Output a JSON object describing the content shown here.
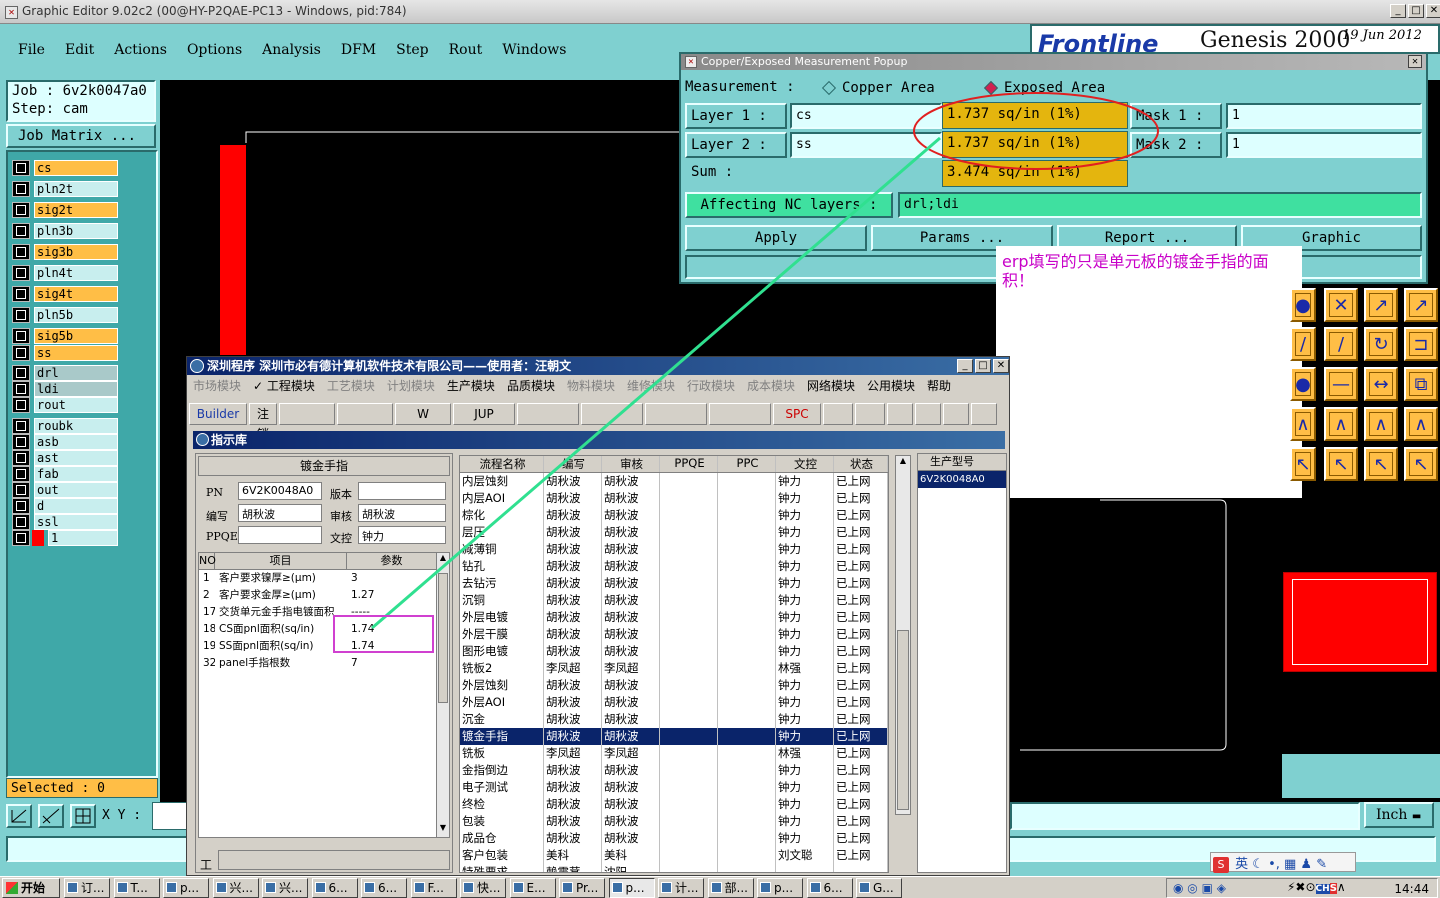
{
  "window": {
    "title": "Graphic Editor 9.02c2 (00@HY-P2QAE-PC13 - Windows, pid:784)"
  },
  "menu": [
    "File",
    "Edit",
    "Actions",
    "Options",
    "Analysis",
    "DFM",
    "Step",
    "Rout",
    "Windows"
  ],
  "banner": {
    "logo": "Frontline",
    "product": "Genesis 2000",
    "date": "19 Jun 2012"
  },
  "job": {
    "job": "Job : 6v2k0047a0",
    "step": "Step: cam",
    "matrix": "Job Matrix ..."
  },
  "layers": [
    {
      "name": "cs",
      "style": "or"
    },
    {
      "name": "pln2t",
      "style": "cy"
    },
    {
      "name": "sig2t",
      "style": "or"
    },
    {
      "name": "pln3b",
      "style": "cy"
    },
    {
      "name": "sig3b",
      "style": "or"
    },
    {
      "name": "pln4t",
      "style": "cy"
    },
    {
      "name": "sig4t",
      "style": "or"
    },
    {
      "name": "pln5b",
      "style": "cy"
    },
    {
      "name": "sig5b",
      "style": "or"
    },
    {
      "name": "ss",
      "style": "or"
    },
    {
      "name": "drl",
      "style": "gr"
    },
    {
      "name": "ldi",
      "style": "gr"
    },
    {
      "name": "rout",
      "style": "cy"
    },
    {
      "name": "roubk",
      "style": "cy"
    },
    {
      "name": "asb",
      "style": "cy"
    },
    {
      "name": "ast",
      "style": "cy"
    },
    {
      "name": "fab",
      "style": "cy"
    },
    {
      "name": "out",
      "style": "cy"
    },
    {
      "name": "d",
      "style": "cy"
    },
    {
      "name": "ssl",
      "style": "cy"
    },
    {
      "name": "1",
      "style": "cy"
    }
  ],
  "selected": "Selected : 0",
  "xy_label": "X Y :",
  "units": "Inch",
  "popup": {
    "title": "Copper/Exposed Measurement Popup",
    "measurement_label": "Measurement :",
    "opt_copper": "Copper Area",
    "opt_exposed": "Exposed Area",
    "layer1_label": "Layer 1 :",
    "layer1_value": "cs",
    "layer1_area": "1.737 sq/in (1%)",
    "mask1_label": "Mask 1 :",
    "mask1_value": "1",
    "layer2_label": "Layer 2 :",
    "layer2_value": "ss",
    "layer2_area": "1.737 sq/in (1%)",
    "mask2_label": "Mask 2 :",
    "mask2_value": "1",
    "sum_label": "Sum :",
    "sum_value": "3.474 sq/in (1%)",
    "nc_label": "Affecting NC layers :",
    "nc_value": "drl;ldi",
    "btn_apply": "Apply",
    "btn_params": "Params ...",
    "btn_report": "Report ...",
    "btn_graphic": "Graphic"
  },
  "note": "erp填写的只是单元板的镀金手指的面积！",
  "erp": {
    "title": "深圳程序   深圳市必有德计算机软件技术有限公司——使用者：汪朝文",
    "menu": [
      {
        "label": "市场模块",
        "g": true
      },
      {
        "label": "✓ 工程模块",
        "g": false
      },
      {
        "label": "工艺模块",
        "g": true
      },
      {
        "label": "计划模块",
        "g": true
      },
      {
        "label": "生产模块",
        "g": false
      },
      {
        "label": "品质模块",
        "g": false
      },
      {
        "label": "物料模块",
        "g": true
      },
      {
        "label": "维修模块",
        "g": true
      },
      {
        "label": "行政模块",
        "g": true
      },
      {
        "label": "成本模块",
        "g": true
      },
      {
        "label": "网络模块",
        "g": false
      },
      {
        "label": "公用模块",
        "g": false
      },
      {
        "label": "帮助",
        "g": false
      }
    ],
    "tools": [
      "Builder",
      "注销",
      "",
      "",
      "W",
      "JUP",
      "",
      "",
      "",
      "",
      "SPC",
      "",
      "",
      "",
      "",
      "",
      ""
    ],
    "subtitle": "指示库",
    "section": "镀金手指",
    "pn_label": "PN",
    "pn_value": "6V2K0048A0",
    "ver_label": "版本",
    "ver_value": "",
    "author_label": "编写",
    "author_value": "胡秋波",
    "review_label": "审核",
    "review_value": "胡秋波",
    "ppqe_label": "PPQE",
    "ppqe_value": "",
    "dc_label": "文控",
    "dc_value": "钟力",
    "param_headers": [
      "NO",
      "项目",
      "参数"
    ],
    "params": [
      [
        "1",
        "客户要求镍厚≥(μm)",
        "3"
      ],
      [
        "2",
        "客户要求金厚≥(μm)",
        "1.27"
      ],
      [
        "17",
        "交货单元金手指电镀面积",
        "-----"
      ],
      [
        "18",
        "CS面pnl面积(sq/in)",
        "1.74"
      ],
      [
        "19",
        "SS面pnl面积(sq/in)",
        "1.74"
      ],
      [
        "32",
        "panel手指根数",
        "7"
      ]
    ],
    "bottom_label": "工",
    "flow_headers": [
      "流程名称",
      "编写",
      "审核",
      "PPQE",
      "PPC",
      "文控",
      "状态"
    ],
    "flows": [
      [
        "内层蚀刻",
        "胡秋波",
        "胡秋波",
        "",
        "",
        "钟力",
        "已上网"
      ],
      [
        "内层AOI",
        "胡秋波",
        "胡秋波",
        "",
        "",
        "钟力",
        "已上网"
      ],
      [
        "棕化",
        "胡秋波",
        "胡秋波",
        "",
        "",
        "钟力",
        "已上网"
      ],
      [
        "层压",
        "胡秋波",
        "胡秋波",
        "",
        "",
        "钟力",
        "已上网"
      ],
      [
        "减薄铜",
        "胡秋波",
        "胡秋波",
        "",
        "",
        "钟力",
        "已上网"
      ],
      [
        "钻孔",
        "胡秋波",
        "胡秋波",
        "",
        "",
        "钟力",
        "已上网"
      ],
      [
        "去钻污",
        "胡秋波",
        "胡秋波",
        "",
        "",
        "钟力",
        "已上网"
      ],
      [
        "沉铜",
        "胡秋波",
        "胡秋波",
        "",
        "",
        "钟力",
        "已上网"
      ],
      [
        "外层电镀",
        "胡秋波",
        "胡秋波",
        "",
        "",
        "钟力",
        "已上网"
      ],
      [
        "外层干膜",
        "胡秋波",
        "胡秋波",
        "",
        "",
        "钟力",
        "已上网"
      ],
      [
        "图形电镀",
        "胡秋波",
        "胡秋波",
        "",
        "",
        "钟力",
        "已上网"
      ],
      [
        "铣板2",
        "李凤超",
        "李凤超",
        "",
        "",
        "林强",
        "已上网"
      ],
      [
        "外层蚀刻",
        "胡秋波",
        "胡秋波",
        "",
        "",
        "钟力",
        "已上网"
      ],
      [
        "外层AOI",
        "胡秋波",
        "胡秋波",
        "",
        "",
        "钟力",
        "已上网"
      ],
      [
        "沉金",
        "胡秋波",
        "胡秋波",
        "",
        "",
        "钟力",
        "已上网"
      ],
      [
        "镀金手指",
        "胡秋波",
        "胡秋波",
        "",
        "",
        "钟力",
        "已上网"
      ],
      [
        "铣板",
        "李凤超",
        "李凤超",
        "",
        "",
        "林强",
        "已上网"
      ],
      [
        "金指倒边",
        "胡秋波",
        "胡秋波",
        "",
        "",
        "钟力",
        "已上网"
      ],
      [
        "电子测试",
        "胡秋波",
        "胡秋波",
        "",
        "",
        "钟力",
        "已上网"
      ],
      [
        "终检",
        "胡秋波",
        "胡秋波",
        "",
        "",
        "钟力",
        "已上网"
      ],
      [
        "包装",
        "胡秋波",
        "胡秋波",
        "",
        "",
        "钟力",
        "已上网"
      ],
      [
        "成品仓",
        "胡秋波",
        "胡秋波",
        "",
        "",
        "钟力",
        "已上网"
      ],
      [
        "客户包装",
        "美科",
        "美科",
        "",
        "",
        "刘文聪",
        "已上网"
      ],
      [
        "特殊要求",
        "赖震茸",
        "沈阳",
        "",
        "",
        "",
        ""
      ]
    ],
    "selected_flow": 15,
    "prod_header": "生产型号",
    "prod_value": "6V2K0048A0"
  },
  "taskbar": {
    "start": "开始",
    "tasks": [
      "订...",
      "T...",
      "p...",
      "兴...",
      "兴...",
      "6...",
      "6...",
      "F...",
      "快...",
      "E...",
      "Pr...",
      "p...",
      "计...",
      "部...",
      "p...",
      "6...",
      "G..."
    ],
    "active": 11,
    "clock": "14:44",
    "ime": "英"
  }
}
